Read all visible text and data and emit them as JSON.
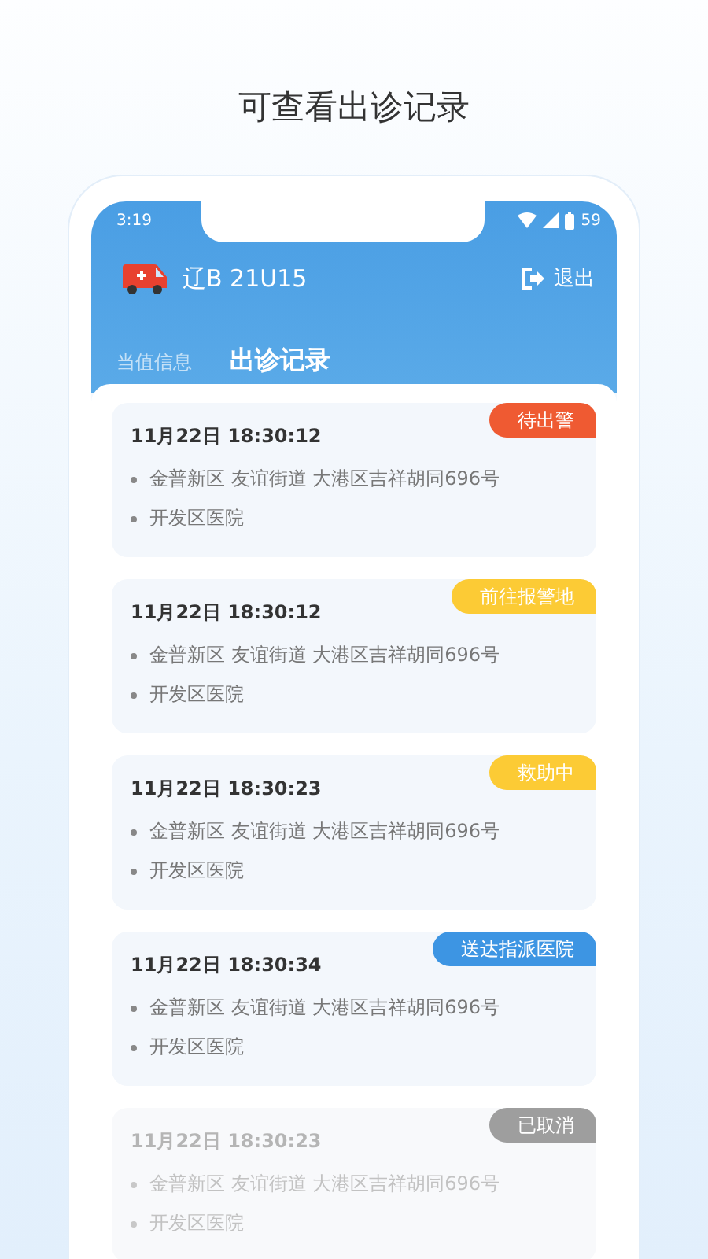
{
  "headline": "可查看出诊记录",
  "status_bar": {
    "time": "3:19",
    "battery": "59"
  },
  "header": {
    "plate": "辽B 21U15",
    "logout": "退出"
  },
  "tabs": [
    {
      "label": "当值信息",
      "selected": false
    },
    {
      "label": "出诊记录",
      "selected": true
    }
  ],
  "records": [
    {
      "time": "11月22日 18:30:12",
      "address": "金普新区 友谊街道 大港区吉祥胡同696号",
      "hospital": "开发区医院",
      "status": "待出警",
      "color": "#ef5a32",
      "faded": false
    },
    {
      "time": "11月22日 18:30:12",
      "address": "金普新区 友谊街道 大港区吉祥胡同696号",
      "hospital": "开发区医院",
      "status": "前往报警地",
      "color": "#fccb35",
      "faded": false
    },
    {
      "time": "11月22日 18:30:23",
      "address": "金普新区 友谊街道 大港区吉祥胡同696号",
      "hospital": "开发区医院",
      "status": "救助中",
      "color": "#fccb35",
      "faded": false
    },
    {
      "time": "11月22日 18:30:34",
      "address": "金普新区 友谊街道 大港区吉祥胡同696号",
      "hospital": "开发区医院",
      "status": "送达指派医院",
      "color": "#3d95e3",
      "faded": false
    },
    {
      "time": "11月22日 18:30:23",
      "address": "金普新区 友谊街道 大港区吉祥胡同696号",
      "hospital": "开发区医院",
      "status": "已取消",
      "color": "#9e9e9e",
      "faded": true
    }
  ]
}
